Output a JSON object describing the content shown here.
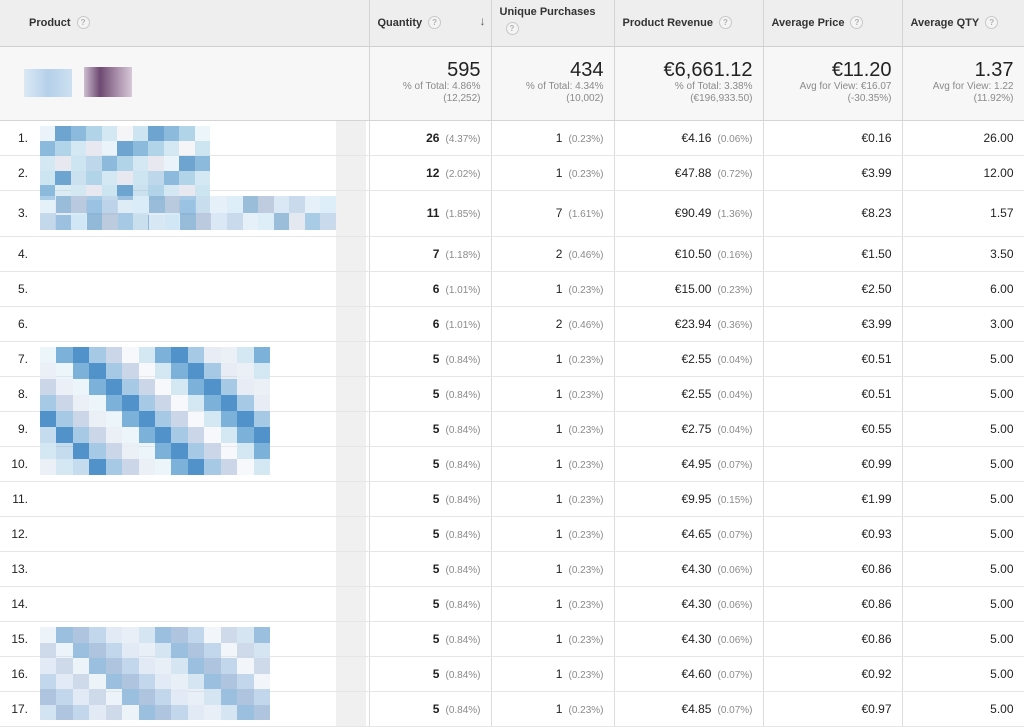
{
  "header": {
    "product": "Product",
    "quantity": "Quantity",
    "unique_purchases": "Unique Purchases",
    "product_revenue": "Product Revenue",
    "average_price": "Average Price",
    "average_qty": "Average QTY",
    "help_glyph": "?",
    "sort_arrow": "↓"
  },
  "totals": {
    "quantity": {
      "value": "595",
      "line1": "% of Total: 4.86%",
      "line2": "(12,252)"
    },
    "unique": {
      "value": "434",
      "line1": "% of Total: 4.34%",
      "line2": "(10,002)"
    },
    "revenue": {
      "value": "€6,661.12",
      "line1": "% of Total: 3.38%",
      "line2": "(€196,933.50)"
    },
    "avg_price": {
      "value": "€11.20",
      "line1": "Avg for View: €16.07",
      "line2": "(-30.35%)"
    },
    "avg_qty": {
      "value": "1.37",
      "line1": "Avg for View: 1.22",
      "line2": "(11.92%)"
    }
  },
  "rows": [
    {
      "index": "1.",
      "qty": "26",
      "qty_pct": "(4.37%)",
      "unique": "1",
      "unique_pct": "(0.23%)",
      "revenue": "€4.16",
      "revenue_pct": "(0.06%)",
      "avg_price": "€0.16",
      "avg_qty": "26.00"
    },
    {
      "index": "2.",
      "qty": "12",
      "qty_pct": "(2.02%)",
      "unique": "1",
      "unique_pct": "(0.23%)",
      "revenue": "€47.88",
      "revenue_pct": "(0.72%)",
      "avg_price": "€3.99",
      "avg_qty": "12.00"
    },
    {
      "index": "3.",
      "qty": "11",
      "qty_pct": "(1.85%)",
      "unique": "7",
      "unique_pct": "(1.61%)",
      "revenue": "€90.49",
      "revenue_pct": "(1.36%)",
      "avg_price": "€8.23",
      "avg_qty": "1.57"
    },
    {
      "index": "4.",
      "qty": "7",
      "qty_pct": "(1.18%)",
      "unique": "2",
      "unique_pct": "(0.46%)",
      "revenue": "€10.50",
      "revenue_pct": "(0.16%)",
      "avg_price": "€1.50",
      "avg_qty": "3.50"
    },
    {
      "index": "5.",
      "qty": "6",
      "qty_pct": "(1.01%)",
      "unique": "1",
      "unique_pct": "(0.23%)",
      "revenue": "€15.00",
      "revenue_pct": "(0.23%)",
      "avg_price": "€2.50",
      "avg_qty": "6.00"
    },
    {
      "index": "6.",
      "qty": "6",
      "qty_pct": "(1.01%)",
      "unique": "2",
      "unique_pct": "(0.46%)",
      "revenue": "€23.94",
      "revenue_pct": "(0.36%)",
      "avg_price": "€3.99",
      "avg_qty": "3.00"
    },
    {
      "index": "7.",
      "qty": "5",
      "qty_pct": "(0.84%)",
      "unique": "1",
      "unique_pct": "(0.23%)",
      "revenue": "€2.55",
      "revenue_pct": "(0.04%)",
      "avg_price": "€0.51",
      "avg_qty": "5.00"
    },
    {
      "index": "8.",
      "qty": "5",
      "qty_pct": "(0.84%)",
      "unique": "1",
      "unique_pct": "(0.23%)",
      "revenue": "€2.55",
      "revenue_pct": "(0.04%)",
      "avg_price": "€0.51",
      "avg_qty": "5.00"
    },
    {
      "index": "9.",
      "qty": "5",
      "qty_pct": "(0.84%)",
      "unique": "1",
      "unique_pct": "(0.23%)",
      "revenue": "€2.75",
      "revenue_pct": "(0.04%)",
      "avg_price": "€0.55",
      "avg_qty": "5.00"
    },
    {
      "index": "10.",
      "qty": "5",
      "qty_pct": "(0.84%)",
      "unique": "1",
      "unique_pct": "(0.23%)",
      "revenue": "€4.95",
      "revenue_pct": "(0.07%)",
      "avg_price": "€0.99",
      "avg_qty": "5.00"
    },
    {
      "index": "11.",
      "qty": "5",
      "qty_pct": "(0.84%)",
      "unique": "1",
      "unique_pct": "(0.23%)",
      "revenue": "€9.95",
      "revenue_pct": "(0.15%)",
      "avg_price": "€1.99",
      "avg_qty": "5.00"
    },
    {
      "index": "12.",
      "qty": "5",
      "qty_pct": "(0.84%)",
      "unique": "1",
      "unique_pct": "(0.23%)",
      "revenue": "€4.65",
      "revenue_pct": "(0.07%)",
      "avg_price": "€0.93",
      "avg_qty": "5.00"
    },
    {
      "index": "13.",
      "qty": "5",
      "qty_pct": "(0.84%)",
      "unique": "1",
      "unique_pct": "(0.23%)",
      "revenue": "€4.30",
      "revenue_pct": "(0.06%)",
      "avg_price": "€0.86",
      "avg_qty": "5.00"
    },
    {
      "index": "14.",
      "qty": "5",
      "qty_pct": "(0.84%)",
      "unique": "1",
      "unique_pct": "(0.23%)",
      "revenue": "€4.30",
      "revenue_pct": "(0.06%)",
      "avg_price": "€0.86",
      "avg_qty": "5.00"
    },
    {
      "index": "15.",
      "qty": "5",
      "qty_pct": "(0.84%)",
      "unique": "1",
      "unique_pct": "(0.23%)",
      "revenue": "€4.30",
      "revenue_pct": "(0.06%)",
      "avg_price": "€0.86",
      "avg_qty": "5.00"
    },
    {
      "index": "16.",
      "qty": "5",
      "qty_pct": "(0.84%)",
      "unique": "1",
      "unique_pct": "(0.23%)",
      "revenue": "€4.60",
      "revenue_pct": "(0.07%)",
      "avg_price": "€0.92",
      "avg_qty": "5.00"
    },
    {
      "index": "17.",
      "qty": "5",
      "qty_pct": "(0.84%)",
      "unique": "1",
      "unique_pct": "(0.23%)",
      "revenue": "€4.85",
      "revenue_pct": "(0.07%)",
      "avg_price": "€0.97",
      "avg_qty": "5.00"
    }
  ]
}
